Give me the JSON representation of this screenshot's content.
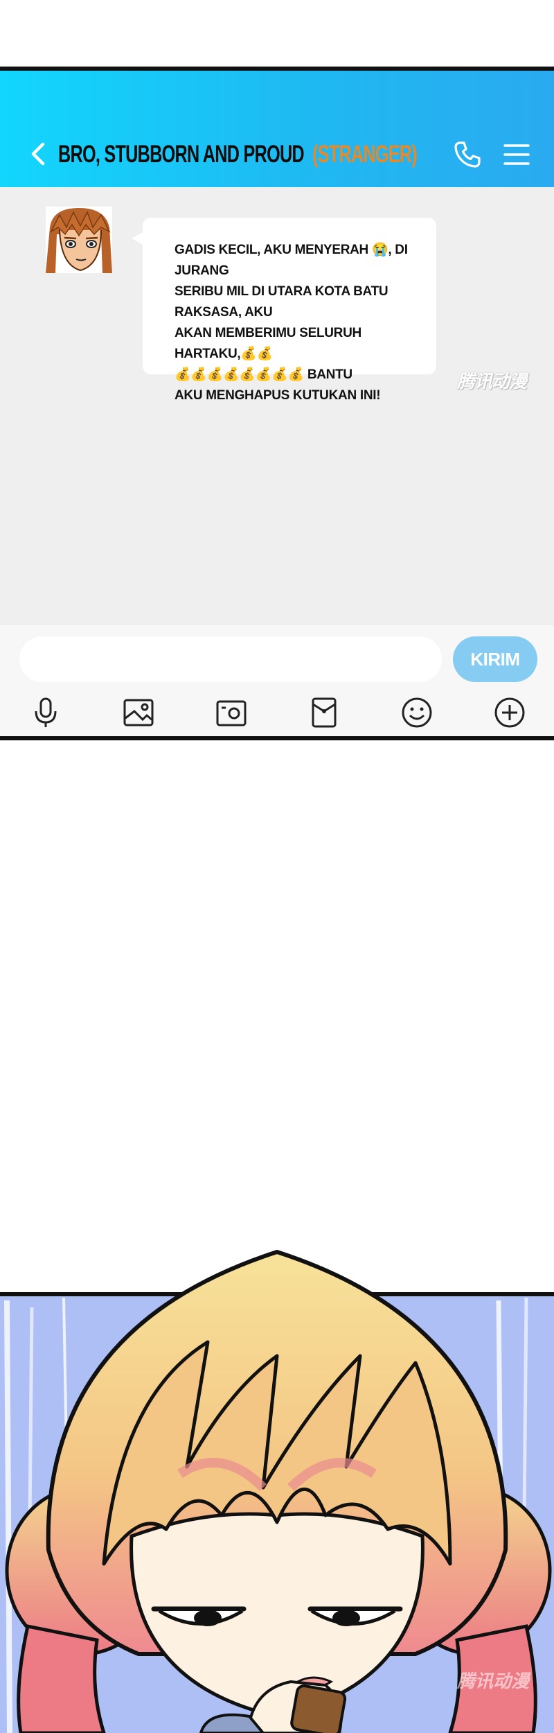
{
  "chat": {
    "header": {
      "contact_name": "BRO, STUBBORN AND PROUD",
      "contact_tag": "(STRANGER)",
      "back_icon": "chevron-left-icon",
      "call_icon": "phone-icon",
      "menu_icon": "menu-icon"
    },
    "message": {
      "lines": [
        "GADIS KECIL, AKU MENYERAH 😭, DI JURANG",
        "SERIBU MIL DI UTARA KOTA BATU RAKSASA, AKU",
        "AKAN MEMBERIMU SELURUH HARTAKU,💰💰",
        "💰💰💰💰💰💰💰💰 BANTU",
        "AKU MENGHAPUS KUTUKAN INI!"
      ]
    },
    "watermark": "腾讯动漫",
    "input": {
      "placeholder": "",
      "value": ""
    },
    "send_label": "KIRIM",
    "toolbar": [
      "microphone-icon",
      "image-icon",
      "camera-icon",
      "red-packet-icon",
      "emoji-icon",
      "plus-icon"
    ]
  },
  "colors": {
    "header_start": "#12d6fd",
    "header_end": "#2aaaf0",
    "tag": "#e38a2c",
    "send_button": "#86ccf2",
    "chat_background": "#efefef"
  },
  "panel2": {
    "watermark": "腾讯动漫"
  }
}
